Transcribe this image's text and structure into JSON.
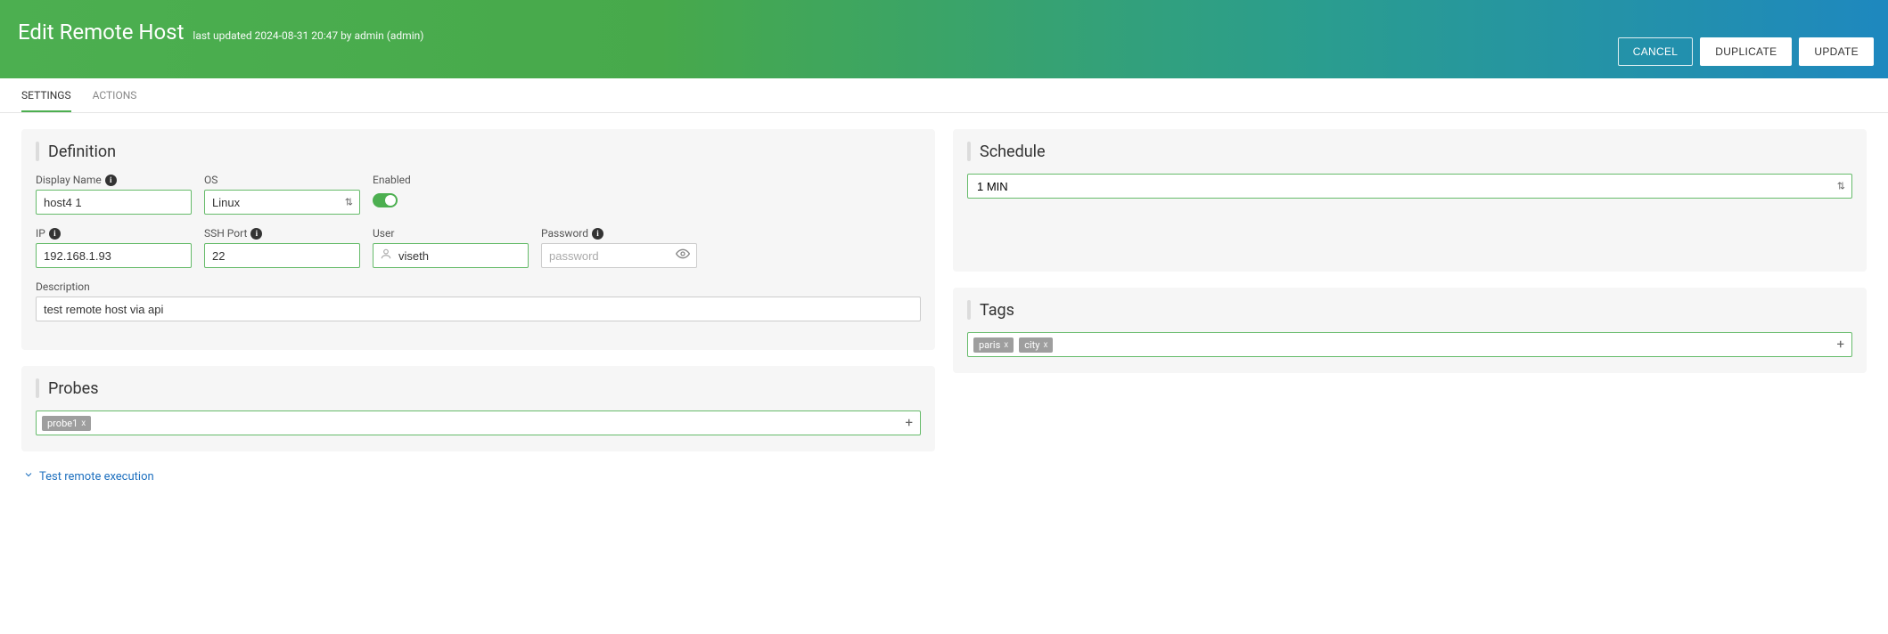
{
  "header": {
    "title": "Edit Remote Host",
    "last_updated_prefix": "last updated",
    "last_updated_timestamp": "2024-08-31 20:47",
    "last_updated_by_prefix": "by",
    "last_updated_by": "admin (admin)"
  },
  "actions": {
    "cancel": "CANCEL",
    "duplicate": "DUPLICATE",
    "update": "UPDATE"
  },
  "tabs": {
    "settings": "SETTINGS",
    "actions": "ACTIONS"
  },
  "definition": {
    "title": "Definition",
    "display_name": {
      "label": "Display Name",
      "value": "host4 1"
    },
    "os": {
      "label": "OS",
      "value": "Linux"
    },
    "enabled": {
      "label": "Enabled",
      "value": true
    },
    "ip": {
      "label": "IP",
      "value": "192.168.1.93"
    },
    "ssh_port": {
      "label": "SSH Port",
      "value": "22"
    },
    "user": {
      "label": "User",
      "value": "viseth"
    },
    "password": {
      "label": "Password",
      "placeholder": "password",
      "value": ""
    },
    "description": {
      "label": "Description",
      "value": "test remote host via api"
    }
  },
  "probes": {
    "title": "Probes",
    "items": [
      "probe1"
    ],
    "test_link": "Test remote execution"
  },
  "schedule": {
    "title": "Schedule",
    "value": "1 MIN"
  },
  "tags": {
    "title": "Tags",
    "items": [
      "paris",
      "city"
    ]
  },
  "icons": {
    "info": "i",
    "plus": "+",
    "close": "x",
    "updown": "⇅",
    "caret": "⌄"
  }
}
